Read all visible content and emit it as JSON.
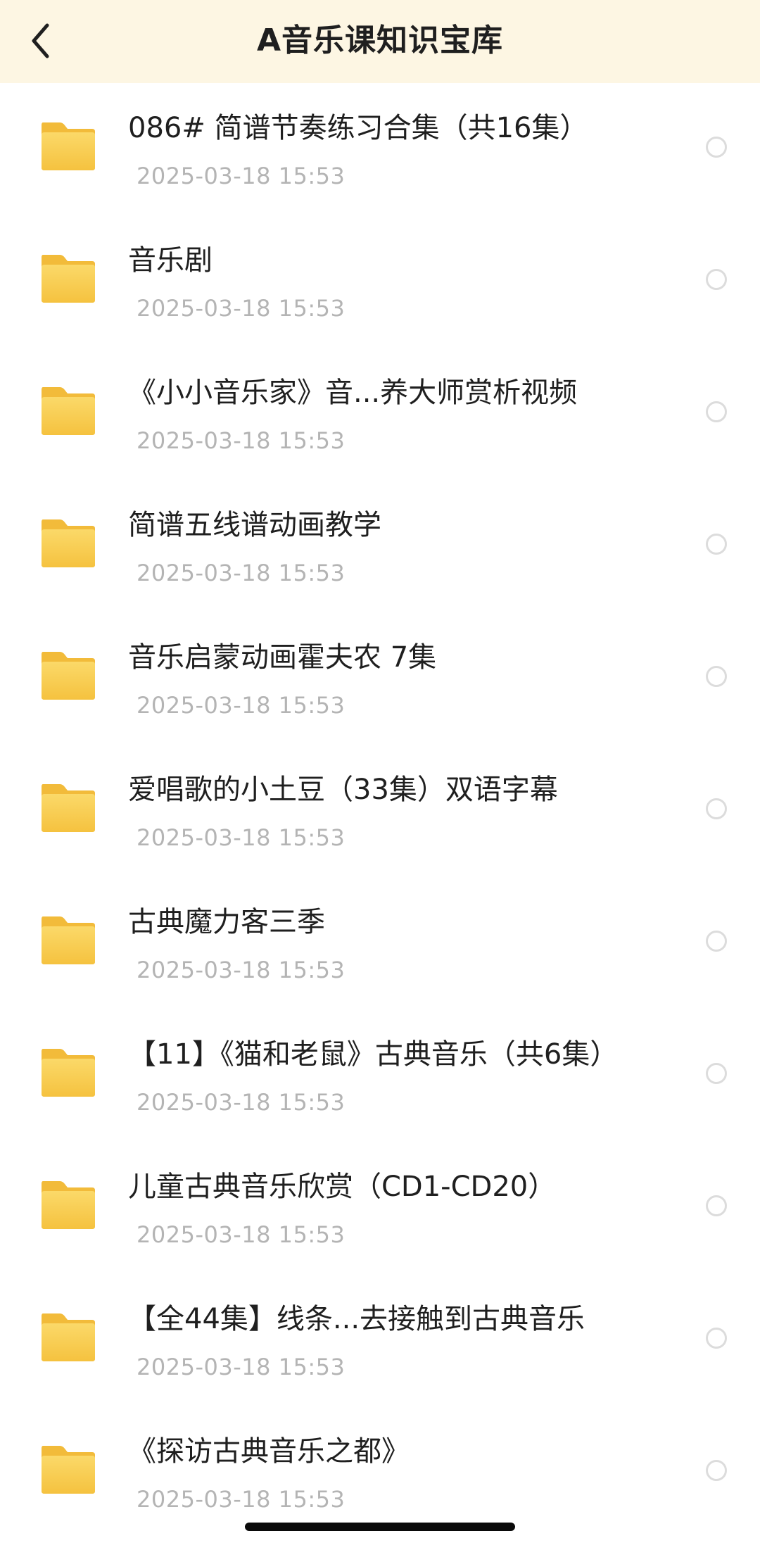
{
  "header": {
    "title": "A音乐课知识宝库",
    "back_icon": "chevron-left-icon"
  },
  "items": [
    {
      "name": "086# 简谱节奏练习合集（共16集）",
      "date": "2025-03-18 15:53"
    },
    {
      "name": "音乐剧",
      "date": "2025-03-18 15:53"
    },
    {
      "name": "《小小音乐家》音...养大师赏析视频",
      "date": "2025-03-18 15:53"
    },
    {
      "name": "简谱五线谱动画教学",
      "date": "2025-03-18 15:53"
    },
    {
      "name": "音乐启蒙动画霍夫农 7集",
      "date": "2025-03-18 15:53"
    },
    {
      "name": "爱唱歌的小土豆（33集）双语字幕",
      "date": "2025-03-18 15:53"
    },
    {
      "name": "古典魔力客三季",
      "date": "2025-03-18 15:53"
    },
    {
      "name": "【11】《猫和老鼠》古典音乐（共6集）",
      "date": "2025-03-18 15:53"
    },
    {
      "name": "儿童古典音乐欣赏（CD1-CD20）",
      "date": "2025-03-18 15:53"
    },
    {
      "name": "【全44集】线条...去接触到古典音乐",
      "date": "2025-03-18 15:53"
    },
    {
      "name": "《探访古典音乐之都》",
      "date": "2025-03-18 15:53"
    }
  ],
  "icons": {
    "folder": "folder-icon",
    "select": "radio-unselected-icon"
  },
  "colors": {
    "header_bg": "#fdf6e3",
    "folder": "#f7c84a",
    "date_text": "#b4b4b4"
  }
}
